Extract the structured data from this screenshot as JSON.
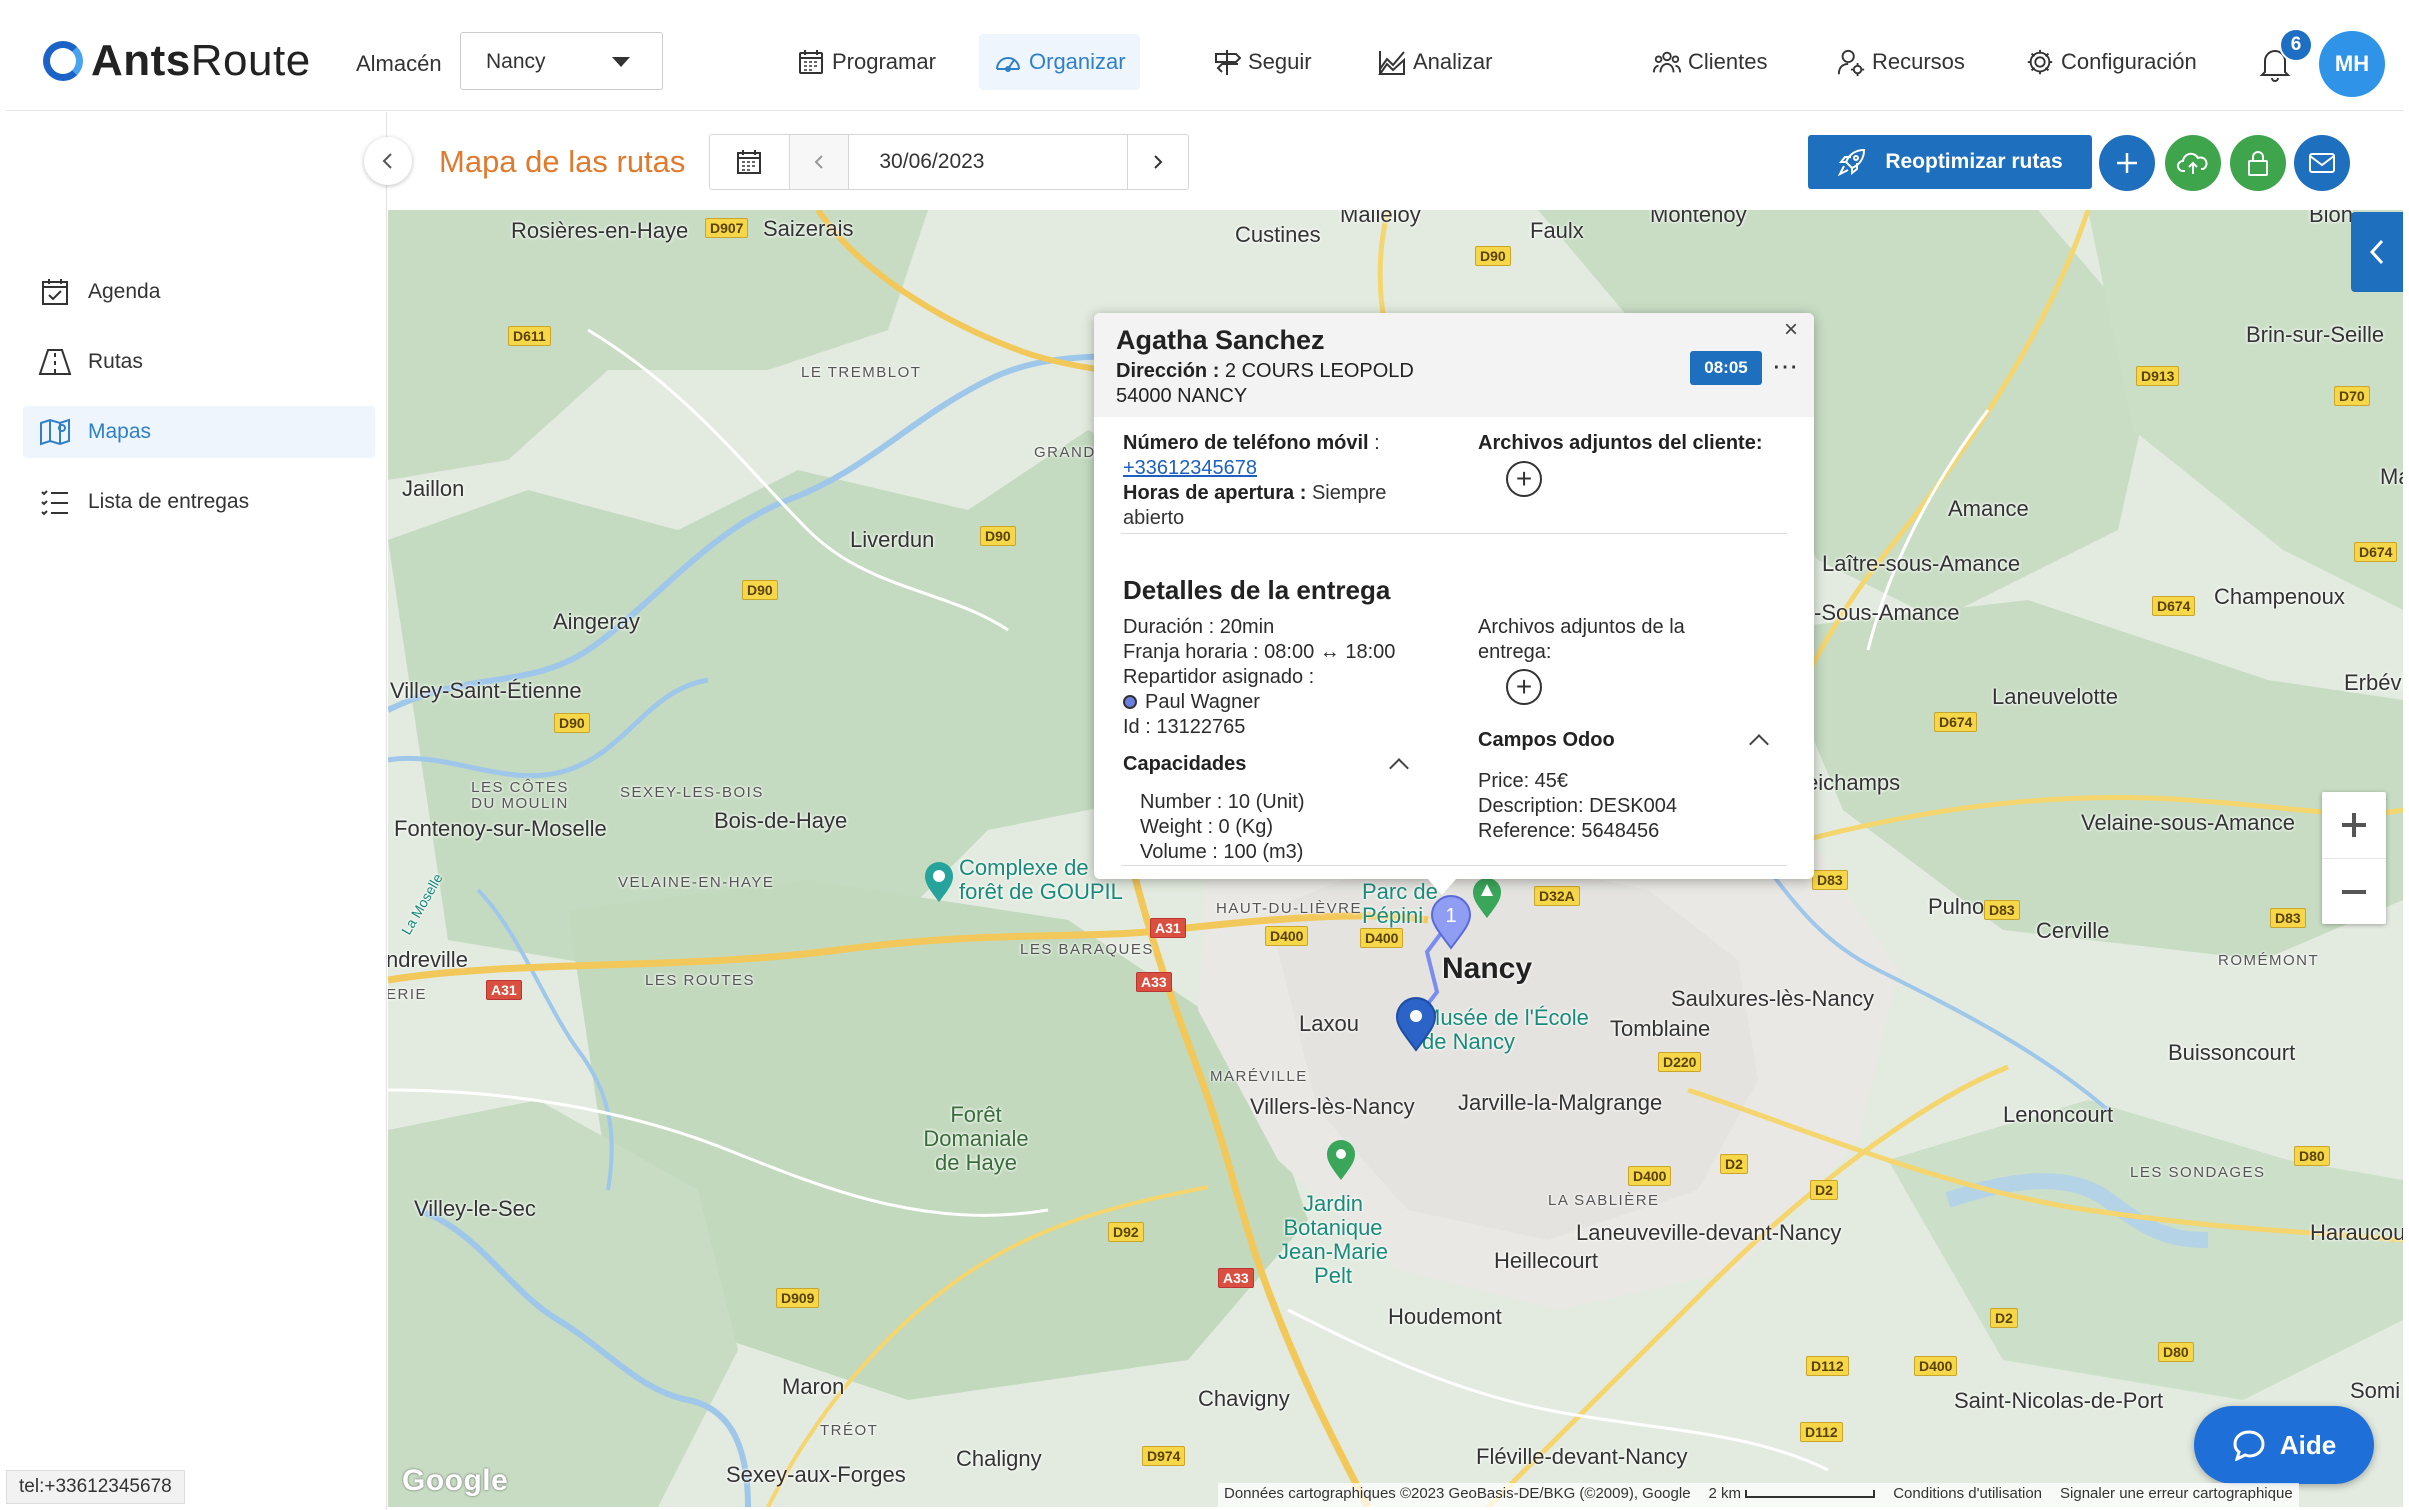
{
  "brand": {
    "name_part1": "Ants",
    "name_part2": "Route"
  },
  "warehouse": {
    "label": "Almacén",
    "value": "Nancy"
  },
  "nav": [
    {
      "label": "Programar",
      "icon": "calendar-icon"
    },
    {
      "label": "Organizar",
      "icon": "speedometer-icon"
    },
    {
      "label": "Seguir",
      "icon": "signpost-icon"
    },
    {
      "label": "Analizar",
      "icon": "chart-icon"
    },
    {
      "label": "Clientes",
      "icon": "people-icon"
    },
    {
      "label": "Recursos",
      "icon": "user-gear-icon"
    },
    {
      "label": "Configuración",
      "icon": "gear-icon"
    }
  ],
  "notifications": {
    "count": "6"
  },
  "user": {
    "initials": "MH"
  },
  "page": {
    "title": "Mapa de las rutas",
    "date": "30/06/2023"
  },
  "actions": {
    "reoptimize": "Reoptimizar rutas"
  },
  "sidebar": [
    {
      "label": "Agenda",
      "icon": "calendar-check-icon"
    },
    {
      "label": "Rutas",
      "icon": "route-icon"
    },
    {
      "label": "Mapas",
      "icon": "map-icon"
    },
    {
      "label": "Lista de entregas",
      "icon": "list-icon"
    }
  ],
  "status_bar": "tel:+33612345678",
  "popup": {
    "name": "Agatha Sanchez",
    "address_label": "Dirección :",
    "address_line1": "2 COURS LEOPOLD",
    "address_line2": "54000 NANCY",
    "time": "08:05",
    "phone_label": "Número de teléfono móvil",
    "phone_sep": " :",
    "phone_value": "+33612345678",
    "hours_label": "Horas de apertura :",
    "hours_value": " Siempre abierto",
    "client_files_label": "Archivos adjuntos del cliente:",
    "delivery_title": "Detalles de la entrega",
    "duration_label": "Duración",
    "duration_value": " : 20min",
    "window_label": "Franja horaria :",
    "window_value": " 08:00 ↔ 18:00",
    "driver_label": "Repartidor asignado :",
    "driver_value": "Paul Wagner",
    "id_label": "Id :",
    "id_value": " 13122765",
    "capacities_title": "Capacidades",
    "cap_number_label": "Number",
    "cap_number_value": " : 10 (Unit)",
    "cap_weight_label": "Weight",
    "cap_weight_value": " : 0 (Kg)",
    "cap_volume_label": "Volume",
    "cap_volume_value": " : 100 (m3)",
    "delivery_files_label": "Archivos adjuntos de la entrega:",
    "odoo_title": "Campos Odoo",
    "price_label": "Price:",
    "price_value": " 45€",
    "desc_label": "Description:",
    "desc_value": " DESK004",
    "ref_label": "Reference:",
    "ref_value": " 5648456"
  },
  "map": {
    "places": [
      "Rosières-en-Haye",
      "Saizerais",
      "Custines",
      "Malleloy",
      "Faulx",
      "Montenoy",
      "Blon",
      "Brin-sur-Seille",
      "LE TREMBLOT",
      "GRAND",
      "Jaillon",
      "Liverdun",
      "Amance",
      "Laître-sous-Amance",
      "Champenoux",
      "Aingeray",
      "-Sous-Amance",
      "Erbévi",
      "Villey-Saint-Étienne",
      "Laneuvelotte",
      "eichamps",
      "LES CÔTES DU MOULIN",
      "SEXEY-LES-BOIS",
      "Bois-de-Haye",
      "Fontenoy-sur-Moselle",
      "Velaine-sous-Amance",
      "VELAINE-EN-HAYE",
      "Complexe de la forêt de GOUPIL",
      "HAUT-DU-LIÈVRE",
      "Parc de Pépini",
      "Pulnoy",
      "Cerville",
      "ndreville",
      "LES BARAQUES",
      "LES ROUTES",
      "ERIE",
      "Nancy",
      "ROMÉMONT",
      "Laxou",
      "Musée de l'École de Nancy",
      "Tomblaine",
      "Saulxures-lès-Nancy",
      "Buissoncourt",
      "MARÉVILLE",
      "Villers-lès-Nancy",
      "Jarville-la-Malgrange",
      "Lenoncourt",
      "Forêt Domaniale de Haye",
      "Villey-le-Sec",
      "Jardin Botanique Jean-Marie Pelt",
      "LA SABLIÈRE",
      "LES SONDAGES",
      "Laneuveville-devant-Nancy",
      "Heillecourt",
      "Haraucou",
      "Houdemont",
      "Maron",
      "Chavigny",
      "TRÉOT",
      "Saint-Nicolas-de-Port",
      "Somi",
      "Chaligny",
      "Sexey-aux-Forges",
      "Fléville-devant-Nancy",
      "La Moselle",
      "Ma"
    ],
    "roads": [
      "D907",
      "D90",
      "D611",
      "D913",
      "D70",
      "D674",
      "D90",
      "D90",
      "D674",
      "D674",
      "D90",
      "D83",
      "D83",
      "D83",
      "D32A",
      "D400",
      "D400",
      "A31",
      "A33",
      "A31",
      "D220",
      "D80",
      "D2",
      "D400",
      "D2",
      "D92",
      "A33",
      "D909",
      "D2",
      "D112",
      "D400",
      "D80",
      "D112",
      "D974"
    ],
    "attribution": [
      "Données cartographiques ©2023 GeoBasis-DE/BKG (©2009), Google",
      "2 km",
      "Conditions d'utilisation",
      "Signaler une erreur cartographique"
    ],
    "google": "Google",
    "stop_number": "1",
    "help": "Aide"
  }
}
